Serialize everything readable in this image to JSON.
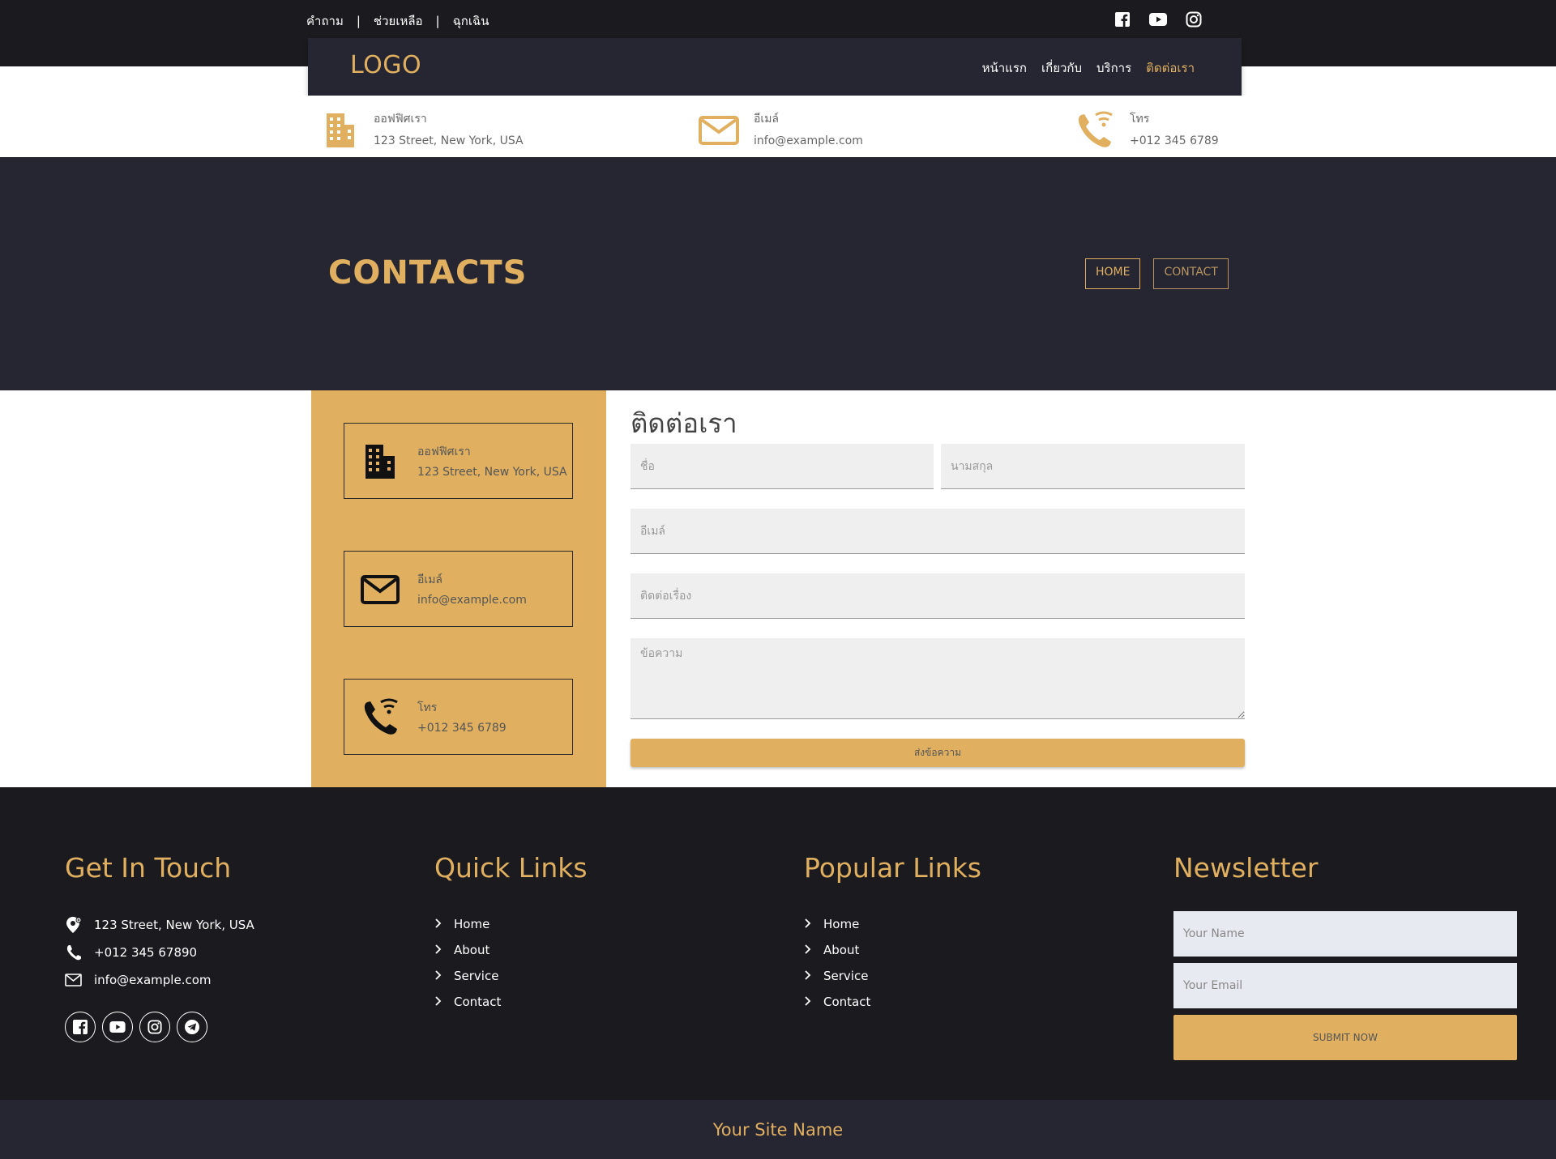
{
  "topbar": {
    "links": [
      "คำถาม",
      "ช่วยเหลือ",
      "ฉุกเฉิน"
    ],
    "separator": "|",
    "social": [
      "facebook-icon",
      "youtube-icon",
      "instagram-icon"
    ]
  },
  "navbar": {
    "logo": "LOGO",
    "links": [
      "หน้าแรก",
      "เกี่ยวกับ",
      "บริการ",
      "ติดต่อเรา"
    ]
  },
  "info": {
    "office": {
      "label": "ออฟฟิศเรา",
      "value": "123 Street, New York, USA",
      "icon": "building-icon"
    },
    "email": {
      "label": "อีเมล์",
      "value": "info@example.com",
      "icon": "mail-icon"
    },
    "phone": {
      "label": "โทร",
      "value": "+012 345 6789",
      "icon": "phone-wifi-icon"
    }
  },
  "banner": {
    "title": "CONTACTS",
    "crumbs": [
      "HOME",
      "CONTACT"
    ]
  },
  "contact": {
    "cards": [
      {
        "label": "ออฟฟิศเรา",
        "value": "123 Street, New York, USA",
        "icon": "building-icon"
      },
      {
        "label": "อีเมล์",
        "value": "info@example.com",
        "icon": "mail-icon"
      },
      {
        "label": "โทร",
        "value": "+012 345 6789",
        "icon": "phone-wifi-icon"
      }
    ],
    "form": {
      "title": "ติดต่อเรา",
      "first_name_placeholder": "ชื่อ",
      "last_name_placeholder": "นามสกุล",
      "email_placeholder": "อีเมล์",
      "subject_placeholder": "ติดต่อเรื่อง",
      "message_placeholder": "ข้อความ",
      "submit_label": "ส่งข้อความ"
    }
  },
  "footer": {
    "get_in_touch": {
      "title": "Get In Touch",
      "address": "123 Street, New York, USA",
      "phone": "+012 345 67890",
      "email": "info@example.com",
      "social": [
        "facebook-icon",
        "youtube-icon",
        "instagram-icon",
        "telegram-icon"
      ]
    },
    "quick_links": {
      "title": "Quick Links",
      "items": [
        "Home",
        "About",
        "Service",
        "Contact"
      ]
    },
    "popular_links": {
      "title": "Popular Links",
      "items": [
        "Home",
        "About",
        "Service",
        "Contact"
      ]
    },
    "newsletter": {
      "title": "Newsletter",
      "name_placeholder": "Your Name",
      "email_placeholder": "Your Email",
      "submit_label": "SUBMIT NOW"
    },
    "site_name": "Your Site Name"
  },
  "colors": {
    "accent": "#e0b060",
    "dark": "#1b1b1f",
    "navy": "#262633"
  }
}
